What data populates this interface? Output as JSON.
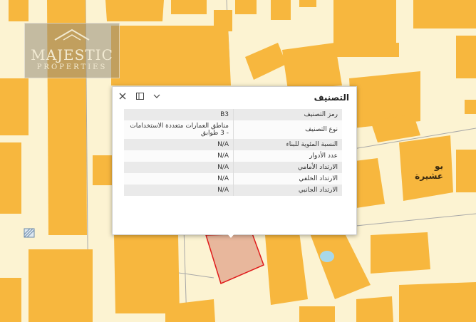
{
  "watermark": {
    "name": "MAJESTIC",
    "tagline": "PROPERTIES"
  },
  "map": {
    "place_label": "بو عشيرة"
  },
  "popup": {
    "title": "التصنيف",
    "rows": [
      {
        "key": "رمز التصنيف",
        "value": "B3"
      },
      {
        "key": "نوع التصنيف",
        "value": "مناطق العمارات متعددة الاستخدامات - 3 طوابق"
      },
      {
        "key": "النسبة المئوية للبناء",
        "value": "N/A"
      },
      {
        "key": "عدد الأدوار",
        "value": "N/A"
      },
      {
        "key": "الارتداد الأمامي",
        "value": "N/A"
      },
      {
        "key": "الارتداد الخلفي",
        "value": "N/A"
      },
      {
        "key": "الارتداد الجانبي",
        "value": "N/A"
      }
    ]
  },
  "colors": {
    "building": "#f7b73e",
    "background": "#fcf3d2",
    "selected_fill": "#e8b79c",
    "selected_stroke": "#e01b1b"
  },
  "icons": {
    "close": "close-icon",
    "dock": "dock-icon",
    "collapse": "chevron-down-icon"
  }
}
